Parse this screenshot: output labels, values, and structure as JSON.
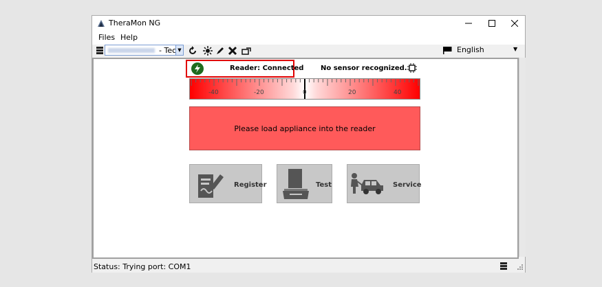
{
  "app": {
    "title": "TheraMon NG"
  },
  "menu": {
    "items": [
      "Files",
      "Help"
    ]
  },
  "toolbar": {
    "account_suffix": "- Tec",
    "icons": [
      "server-icon",
      "refresh-icon",
      "sun-icon",
      "pen-icon",
      "close-icon",
      "export-icon"
    ],
    "language": "English"
  },
  "header": {
    "reader_status": "Reader: Connected",
    "sensor_status": "No sensor recognized."
  },
  "scale": {
    "ticks": [
      "-40",
      "-20",
      "0",
      "20",
      "40"
    ]
  },
  "message": {
    "text": "Please load appliance into the reader"
  },
  "actions": [
    {
      "label": "Register",
      "icon": "register-icon"
    },
    {
      "label": "Test",
      "icon": "scanner-icon"
    },
    {
      "label": "Service",
      "icon": "car-service-icon"
    }
  ],
  "status": {
    "text": "Status: Trying port: COM1"
  },
  "colors": {
    "accent": "#ff0000",
    "message_bg": "#ff5a5a",
    "connected": "#1e6b1e"
  }
}
